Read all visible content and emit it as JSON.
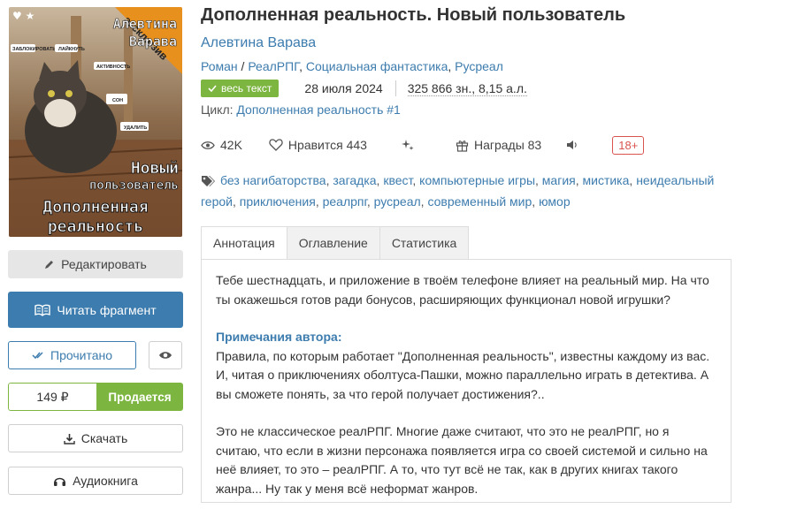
{
  "cover": {
    "badge": "эксклюзив",
    "author_top": "Алевтина Варава",
    "title_art_line1": "Новый пользователь",
    "title_art_line2": "Дополненная реальность",
    "app_labels": [
      "ЗАБЛОКИРОВАТЬ",
      "ЛАЙКНУТЬ",
      "АКТИВНОСТЬ",
      "СОН",
      "УДАЛИТЬ"
    ]
  },
  "actions": {
    "edit": "Редактировать",
    "read_fragment": "Читать фрагмент",
    "read_done": "Прочитано",
    "price": "149 ₽",
    "on_sale": "Продается",
    "download": "Скачать",
    "audiobook": "Аудиокнига"
  },
  "book": {
    "title": "Дополненная реальность. Новый пользователь",
    "author": "Алевтина Варава",
    "genres": [
      "Роман",
      "РеалРПГ",
      "Социальная фантастика",
      "Русреал"
    ],
    "full_text_badge": "весь текст",
    "date": "28 июля 2024",
    "size": "325 866 зн., 8,15 а.л.",
    "cycle_label": "Цикл:",
    "cycle_name": "Дополненная реальность #1"
  },
  "stats": {
    "views": "42K",
    "likes": "Нравится 443",
    "awards": "Награды 83",
    "age": "18+"
  },
  "tags": [
    "без нагибаторства",
    "загадка",
    "квест",
    "компьютерные игры",
    "магия",
    "мистика",
    "неидеальный герой",
    "приключения",
    "реалрпг",
    "русреал",
    "современный мир",
    "юмор"
  ],
  "tabs": [
    "Аннотация",
    "Оглавление",
    "Статистика"
  ],
  "annotation": {
    "p1": "Тебе шестнадцать, и приложение в твоём телефоне влияет на реальный мир. На что ты окажешься готов ради бонусов, расширяющих функционал новой игрушки?",
    "notes_heading": "Примечания автора:",
    "p2": "Правила, по которым работает \"Дополненная реальность\", известны каждому из вас. И, читая о приключениях оболтуса-Пашки, можно параллельно играть в детектива. А вы сможете понять, за что герой получает достижения?..",
    "p3": "Это не классическое реалРПГ. Многие даже считают, что это не реалРПГ, но я считаю, что если в жизни персонажа появляется игра со своей системой и сильно на неё влияет, то это – реалРПГ. А то, что тут всё не так, как в других книгах такого жанра... Ну так у меня всё неформат жанров."
  },
  "colors": {
    "link": "#3d7cae",
    "green": "#7cb53f",
    "age": "#d9534f"
  }
}
